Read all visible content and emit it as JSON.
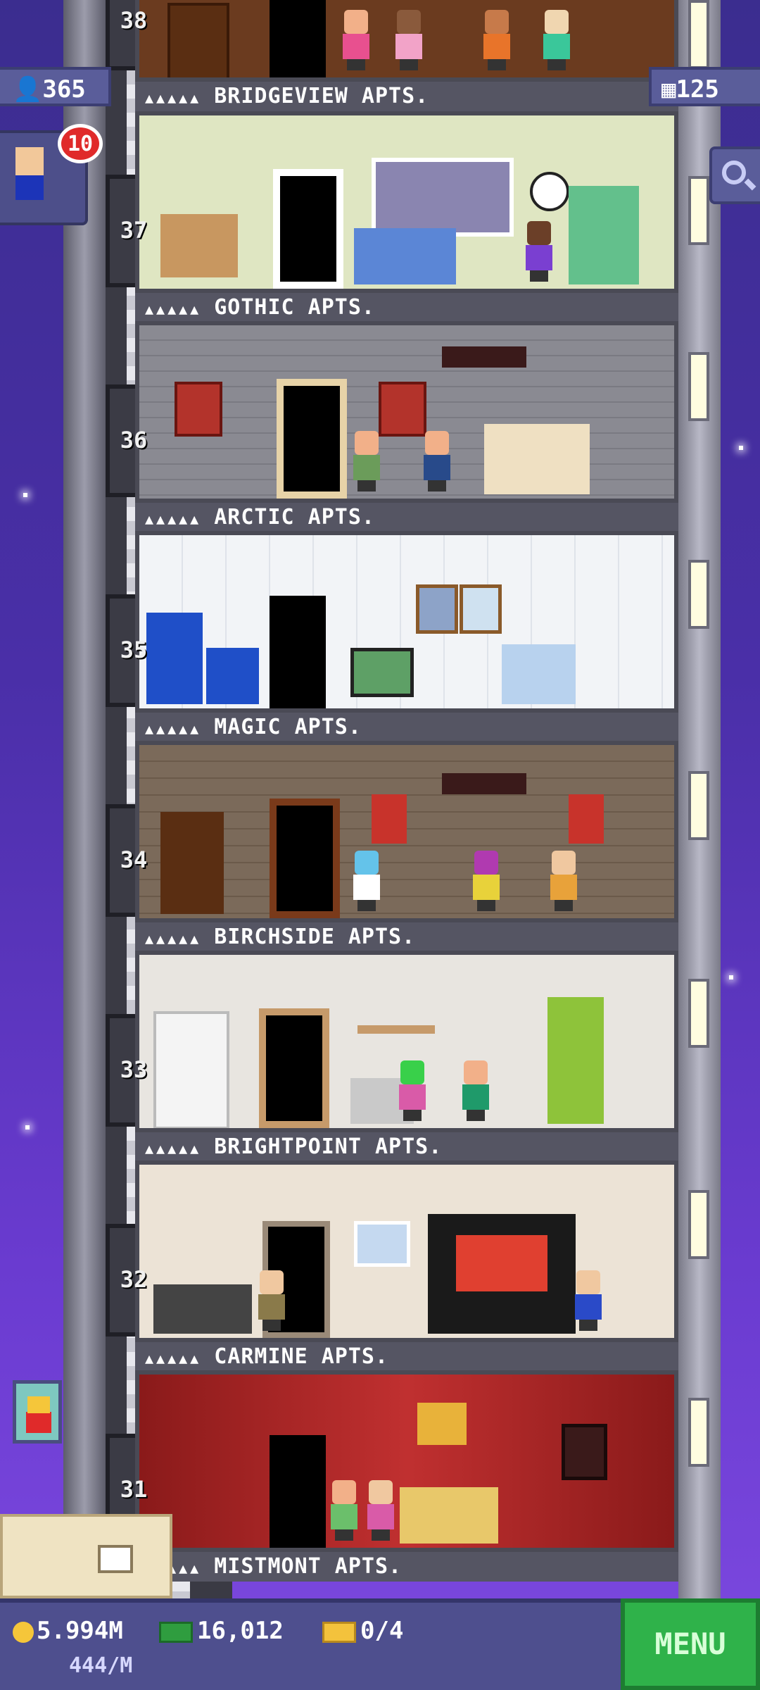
{
  "hud": {
    "population": "365",
    "tower_bux_top": "125",
    "visitor_count": "10",
    "coins": "5.994M",
    "coin_rate": "444/M",
    "bux": "16,012",
    "tickets": "0/4",
    "menu_label": "MENU"
  },
  "floors": [
    {
      "number": "38",
      "name": "BRIDGEVIEW APTS.",
      "stars": "▲▲▲▲▲"
    },
    {
      "number": "37",
      "name": "GOTHIC APTS.",
      "stars": "▲▲▲▲▲"
    },
    {
      "number": "36",
      "name": "ARCTIC APTS.",
      "stars": "▲▲▲▲▲"
    },
    {
      "number": "35",
      "name": "MAGIC APTS.",
      "stars": "▲▲▲▲▲"
    },
    {
      "number": "34",
      "name": "BIRCHSIDE APTS.",
      "stars": "▲▲▲▲▲"
    },
    {
      "number": "33",
      "name": "BRIGHTPOINT APTS.",
      "stars": "▲▲▲▲▲"
    },
    {
      "number": "32",
      "name": "CARMINE APTS.",
      "stars": "▲▲▲▲▲"
    },
    {
      "number": "31",
      "name": "MISTMONT APTS.",
      "stars": "▲▲▲▲▲"
    }
  ],
  "colors": {
    "accent_green": "#2fb24a",
    "hud_panel": "#5a5d9a",
    "badge_red": "#e02a2a"
  }
}
